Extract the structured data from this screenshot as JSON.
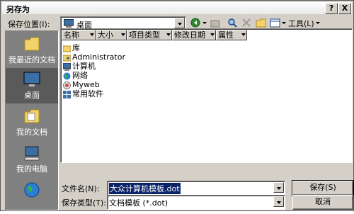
{
  "window": {
    "title": "另存为",
    "help_btn": "?",
    "close_btn": "X"
  },
  "save_in": {
    "label": "保存位置(I):",
    "value": "桌面"
  },
  "toolbar": {
    "tools_label": "工具(L)"
  },
  "places": [
    {
      "label": "我最近的文档",
      "icon": "recent-docs-icon"
    },
    {
      "label": "桌面",
      "icon": "desktop-icon",
      "selected": true
    },
    {
      "label": "我的文档",
      "icon": "my-documents-icon"
    },
    {
      "label": "我的电脑",
      "icon": "my-computer-icon"
    },
    {
      "label": "",
      "icon": "network-globe-icon"
    }
  ],
  "columns": [
    "名称",
    "大小",
    "项目类型",
    "修改日期",
    "属性"
  ],
  "items": [
    {
      "name": "库",
      "icon": "library-icon"
    },
    {
      "name": "Administrator",
      "icon": "user-folder-icon"
    },
    {
      "name": "计算机",
      "icon": "computer-icon"
    },
    {
      "name": "网络",
      "icon": "network-icon"
    },
    {
      "name": "Myweb",
      "icon": "web-icon"
    },
    {
      "name": "常用软件",
      "icon": "software-icon"
    }
  ],
  "filename": {
    "label": "文件名(N):",
    "value": "大众计算机模板.dot"
  },
  "filetype": {
    "label": "保存类型(T):",
    "value": "文档模板 (*.dot)"
  },
  "buttons": {
    "save": "保存(S)",
    "cancel": "取消"
  }
}
